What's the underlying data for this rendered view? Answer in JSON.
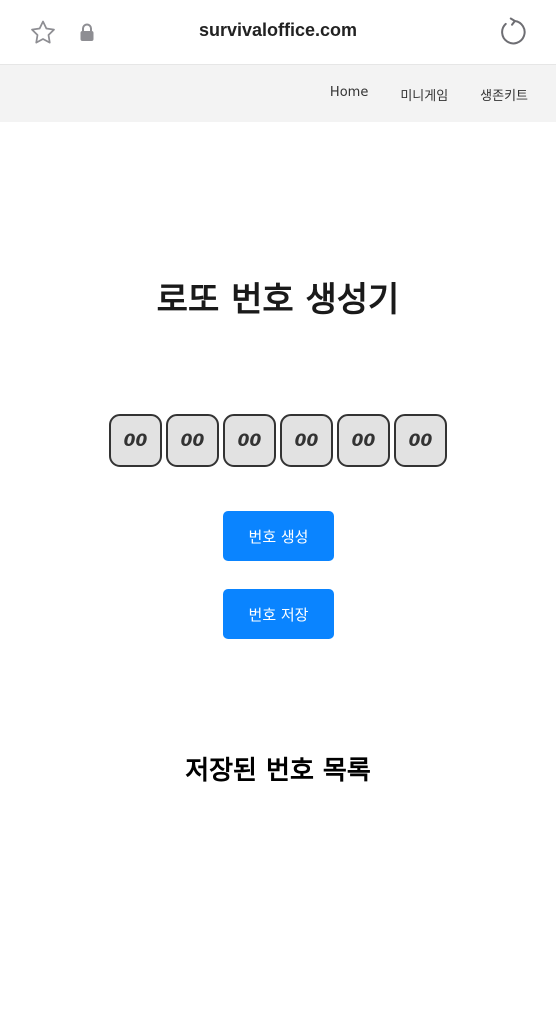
{
  "browser": {
    "url": "survivaloffice.com",
    "icons": {
      "bookmark": "star-icon",
      "security": "lock-icon",
      "reload": "reload-icon"
    }
  },
  "nav": {
    "links": [
      "Home",
      "미니게임",
      "생존키트"
    ]
  },
  "main": {
    "title": "로또 번호 생성기",
    "balls": [
      "00",
      "00",
      "00",
      "00",
      "00",
      "00"
    ],
    "generate_label": "번호 생성",
    "save_label": "번호 저장"
  },
  "saved": {
    "title": "저장된 번호 목록",
    "items": []
  },
  "colors": {
    "accent": "#0a84ff",
    "ball_fill": "#e2e2e2",
    "ball_border": "#333333",
    "nav_bg": "#f3f3f3"
  }
}
